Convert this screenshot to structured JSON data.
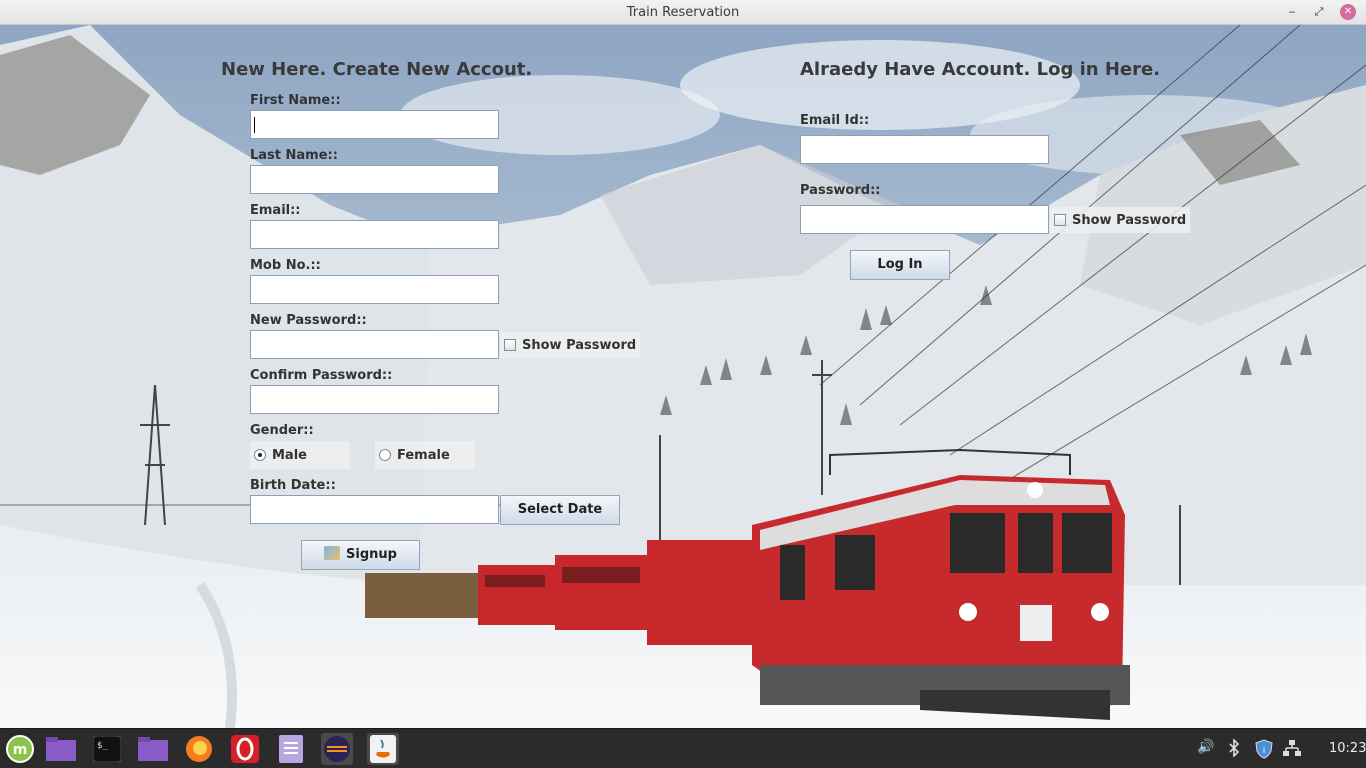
{
  "window": {
    "title": "Train Reservation",
    "min_icon": "‒",
    "max_icon": "⤢",
    "close_icon": "✕"
  },
  "signup": {
    "heading": "New Here. Create New Accout.",
    "first_name_label": "First Name::",
    "last_name_label": "Last Name::",
    "email_label": "Email::",
    "mob_label": "Mob No.::",
    "new_password_label": "New Password::",
    "show_password_label": "Show Password",
    "confirm_password_label": "Confirm Password::",
    "gender_label": "Gender::",
    "gender_options": [
      "Male",
      "Female"
    ],
    "gender_selected": "Male",
    "birth_date_label": "Birth Date::",
    "select_date_button": "Select Date",
    "signup_button": "Signup"
  },
  "login": {
    "heading": "Alraedy Have Account. Log in Here.",
    "email_label": "Email Id::",
    "password_label": "Password::",
    "show_password_label": "Show Password",
    "login_button": "Log In"
  },
  "taskbar": {
    "apps": [
      "mint-menu-icon",
      "files-icon",
      "terminal-icon",
      "folder-icon",
      "firefox-icon",
      "opera-icon",
      "text-editor-icon",
      "eclipse-icon",
      "java-icon"
    ],
    "tray": [
      "volume-icon",
      "bluetooth-icon",
      "update-shield-icon",
      "network-icon"
    ],
    "clock": "10:23"
  },
  "colors": {
    "train_red": "#c8282c",
    "sky": "#9fb5cf",
    "snow": "#f2f4f6",
    "taskbar": "#2b2b2b"
  }
}
